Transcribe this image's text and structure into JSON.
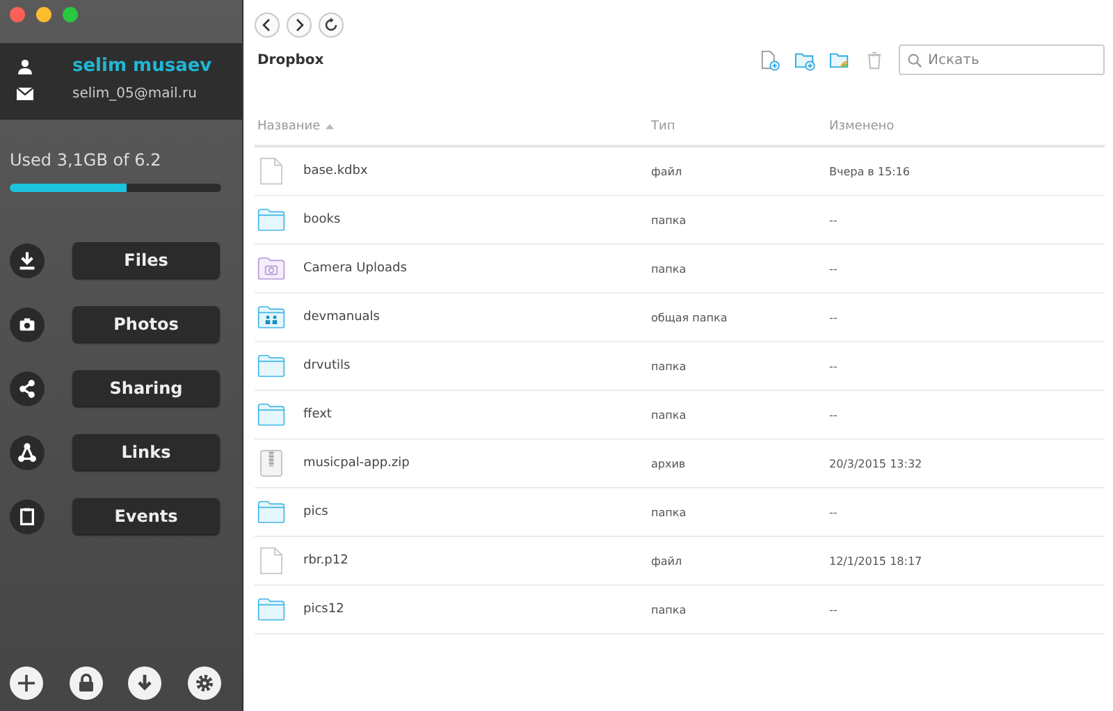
{
  "user": {
    "name": "selim musaev",
    "email": "selim_05@mail.ru"
  },
  "storage": {
    "label": "Used 3,1GB of 6.2",
    "level": 0.55
  },
  "nav": [
    {
      "kind": "files",
      "label": "Files"
    },
    {
      "kind": "photos",
      "label": "Photos"
    },
    {
      "kind": "sharing",
      "label": "Sharing"
    },
    {
      "kind": "links",
      "label": "Links"
    },
    {
      "kind": "events",
      "label": "Events"
    }
  ],
  "bottom_actions": [
    {
      "kind": "add"
    },
    {
      "kind": "lock"
    },
    {
      "kind": "download"
    },
    {
      "kind": "settings"
    }
  ],
  "folder_title": "Dropbox",
  "search": {
    "placeholder": "Искать"
  },
  "table": {
    "columns": [
      "Название",
      "Тип",
      "Изменено"
    ],
    "rows": [
      {
        "kind": "file",
        "name": "base.kdbx",
        "type": "файл",
        "modified": "Вчера в 15:16"
      },
      {
        "kind": "folder",
        "name": "books",
        "type": "папка",
        "modified": "--"
      },
      {
        "kind": "camera-folder",
        "name": "Camera Uploads",
        "type": "папка",
        "modified": "--"
      },
      {
        "kind": "shared-folder",
        "name": "devmanuals",
        "type": "общая папка",
        "modified": "--"
      },
      {
        "kind": "folder",
        "name": "drvutils",
        "type": "папка",
        "modified": "--"
      },
      {
        "kind": "folder",
        "name": "ffext",
        "type": "папка",
        "modified": "--"
      },
      {
        "kind": "archive",
        "name": "musicpal-app.zip",
        "type": "архив",
        "modified": "20/3/2015 13:32"
      },
      {
        "kind": "folder",
        "name": "pics",
        "type": "папка",
        "modified": "--"
      },
      {
        "kind": "file",
        "name": "rbr.p12",
        "type": "файл",
        "modified": "12/1/2015 18:17"
      },
      {
        "kind": "folder",
        "name": "pics12",
        "type": "папка",
        "modified": "--"
      }
    ]
  }
}
